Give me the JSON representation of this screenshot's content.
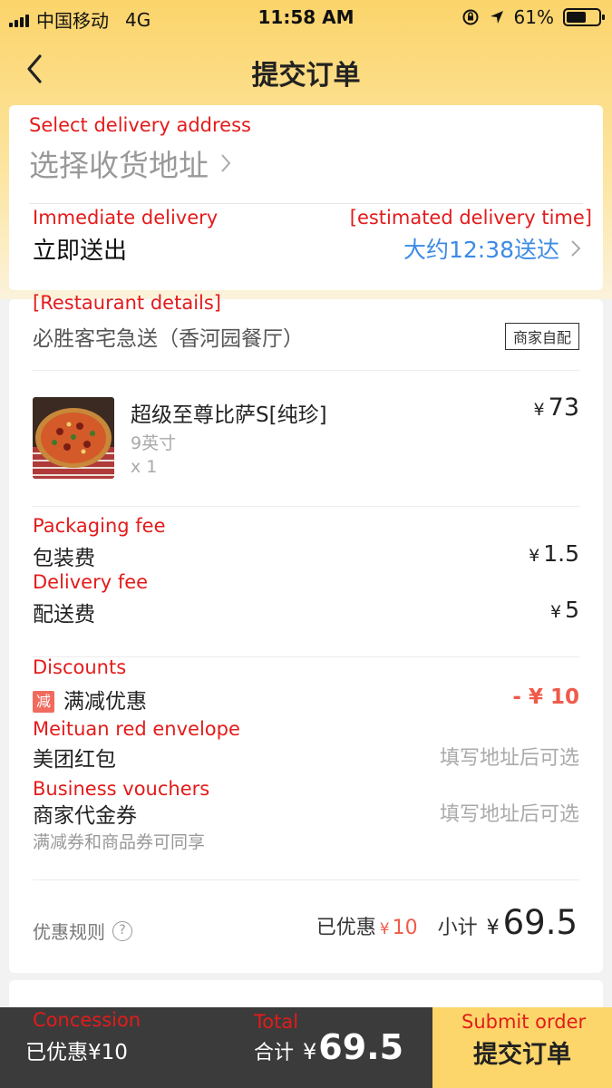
{
  "status_bar": {
    "carrier": "中国移动",
    "network": "4G",
    "time": "11:58 AM",
    "battery": "61%",
    "battery_level": 0.61
  },
  "nav": {
    "back_icon": "chevron-left-icon",
    "title": "提交订单"
  },
  "address": {
    "annotation": "Select delivery address",
    "placeholder": "选择收货地址",
    "chevron": "›",
    "delivery_annotation": "Immediate delivery",
    "delivery_mode": "立即送出",
    "time_annotation": "[estimated delivery time]",
    "estimated_time": "大约12:38送达"
  },
  "restaurant": {
    "annotation": "[Restaurant details]",
    "name": "必胜客宅急送（香河园餐厅）",
    "badge": "商家自配"
  },
  "item": {
    "name": "超级至尊比萨S[纯珍]",
    "spec": "9英寸",
    "qty": "x 1",
    "currency": "¥",
    "price": "73"
  },
  "fees": {
    "packaging_annotation": "Packaging fee",
    "packaging_label": "包装费",
    "packaging_value": "1.5",
    "delivery_annotation": "Delivery fee",
    "delivery_label": "配送费",
    "delivery_value": "5",
    "currency": "¥"
  },
  "discounts": {
    "annotation": "Discounts",
    "icon_text": "减",
    "label": "满减优惠",
    "value": "- ¥ 10",
    "redpacket_annotation": "Meituan red envelope",
    "redpacket_label": "美团红包",
    "redpacket_hint": "填写地址后可选",
    "voucher_annotation": "Business vouchers",
    "voucher_label": "商家代金券",
    "voucher_hint": "填写地址后可选",
    "voucher_note": "满减券和商品券可同享"
  },
  "summary": {
    "rules_label": "优惠规则",
    "saved_label": "已优惠",
    "saved_currency": "¥",
    "saved_value": "10",
    "subtotal_label": "小计",
    "subtotal_currency": "¥",
    "subtotal_value": "69.5"
  },
  "bottom_bar": {
    "concession_annotation": "Concession",
    "saved_text": "已优惠¥10",
    "total_annotation": "Total",
    "total_label": "合计",
    "total_currency": "¥",
    "total_value": "69.5",
    "submit_annotation": "Submit order",
    "submit_label": "提交订单"
  },
  "colors": {
    "brand_yellow": "#fcd66a",
    "annotation_red": "#e31b1b",
    "discount_red": "#f05a4a",
    "time_blue": "#3d8be5",
    "bottom_dark": "#3b3b3b"
  }
}
